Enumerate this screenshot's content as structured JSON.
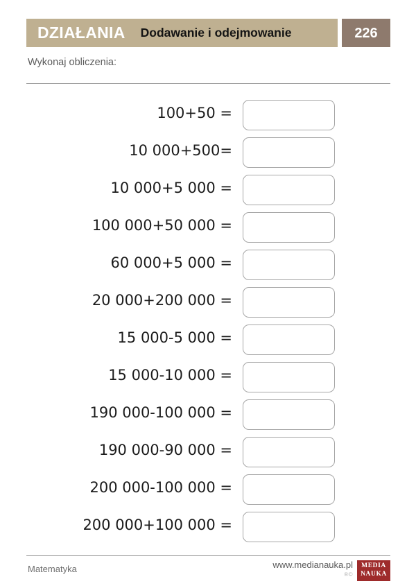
{
  "header": {
    "category": "DZIAŁANIA",
    "topic": "Dodawanie i odejmowanie",
    "page_number": "226",
    "bar_color": "#bfb091",
    "badge_color": "#8e7a6d"
  },
  "instruction": "Wykonaj obliczenia:",
  "exercises": [
    {
      "expression": "100+50 ="
    },
    {
      "expression": "10 000+500="
    },
    {
      "expression": "10 000+5 000 ="
    },
    {
      "expression": "100 000+50 000 ="
    },
    {
      "expression": "60 000+5 000 ="
    },
    {
      "expression": "20 000+200 000 ="
    },
    {
      "expression": "15 000-5 000 ="
    },
    {
      "expression": "15 000-10 000 ="
    },
    {
      "expression": "190 000-100 000 ="
    },
    {
      "expression": "190 000-90 000 ="
    },
    {
      "expression": "200 000-100 000 ="
    },
    {
      "expression": "200 000+100 000 ="
    }
  ],
  "footer": {
    "subject": "Matematyka",
    "url": "www.medianauka.pl",
    "marks": "®©",
    "logo_line1": "MEDIA",
    "logo_line2": "NAUKA",
    "logo_color": "#9e2b2b"
  }
}
